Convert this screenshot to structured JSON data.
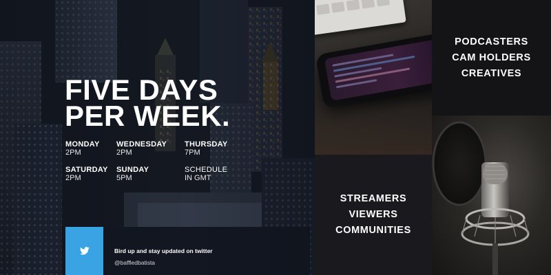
{
  "headline": {
    "line1": "FIVE DAYS",
    "line2": "PER WEEK."
  },
  "schedule": [
    {
      "day": "MONDAY",
      "time": "2PM"
    },
    {
      "day": "WEDNESDAY",
      "time": "2PM"
    },
    {
      "day": "THURSDAY",
      "time": "7PM"
    },
    {
      "day": "SATURDAY",
      "time": "2PM"
    },
    {
      "day": "SUNDAY",
      "time": "5PM"
    }
  ],
  "schedule_note": {
    "line1": "SCHEDULE",
    "line2": "IN GMT"
  },
  "twitter": {
    "icon": "twitter-bird-icon",
    "text": "Bird up and stay updated on twitter",
    "handle": "@baffledbatista",
    "color": "#3aa3e3"
  },
  "audience_top": [
    "PODCASTERS",
    "CAM HOLDERS",
    "CREATIVES"
  ],
  "audience_mid": [
    "STREAMERS",
    "VIEWERS",
    "COMMUNITIES"
  ],
  "colors": {
    "panel_dark": "#141417",
    "panel_mid": "#1a1a1e",
    "text": "#ffffff",
    "twitter_blue": "#3aa3e3"
  }
}
